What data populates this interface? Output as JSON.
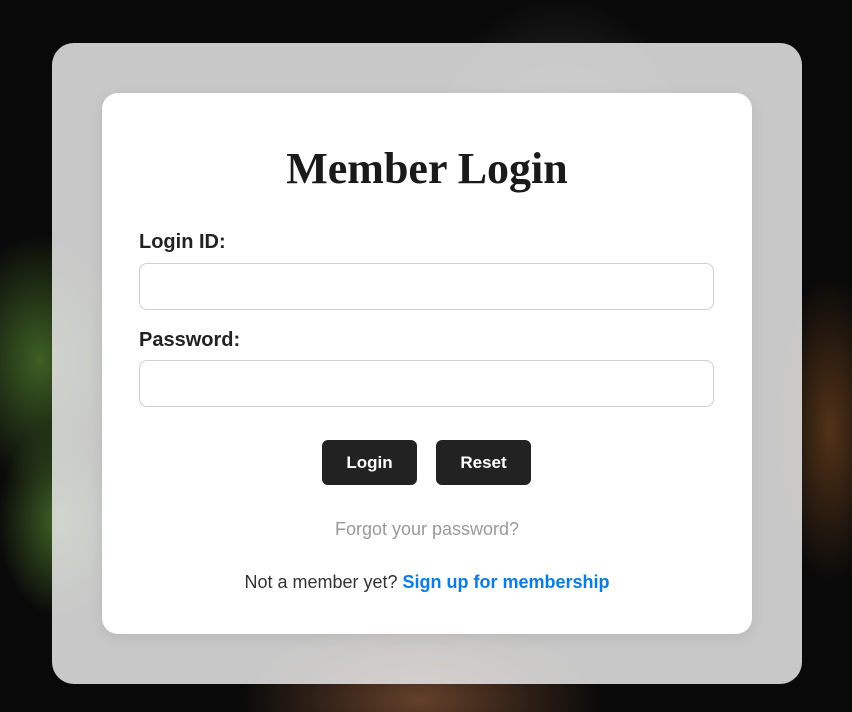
{
  "page": {
    "title": "Member Login"
  },
  "form": {
    "login_id": {
      "label": "Login ID:",
      "value": "",
      "placeholder": ""
    },
    "password": {
      "label": "Password:",
      "value": "",
      "placeholder": ""
    }
  },
  "buttons": {
    "login_label": "Login",
    "reset_label": "Reset"
  },
  "links": {
    "forgot_password": "Forgot your password?",
    "not_member_text": "Not a member yet?",
    "signup_label": "Sign up for membership"
  },
  "colors": {
    "button_bg": "#222222",
    "link_accent": "#0a7be0",
    "muted_link": "#999999"
  }
}
